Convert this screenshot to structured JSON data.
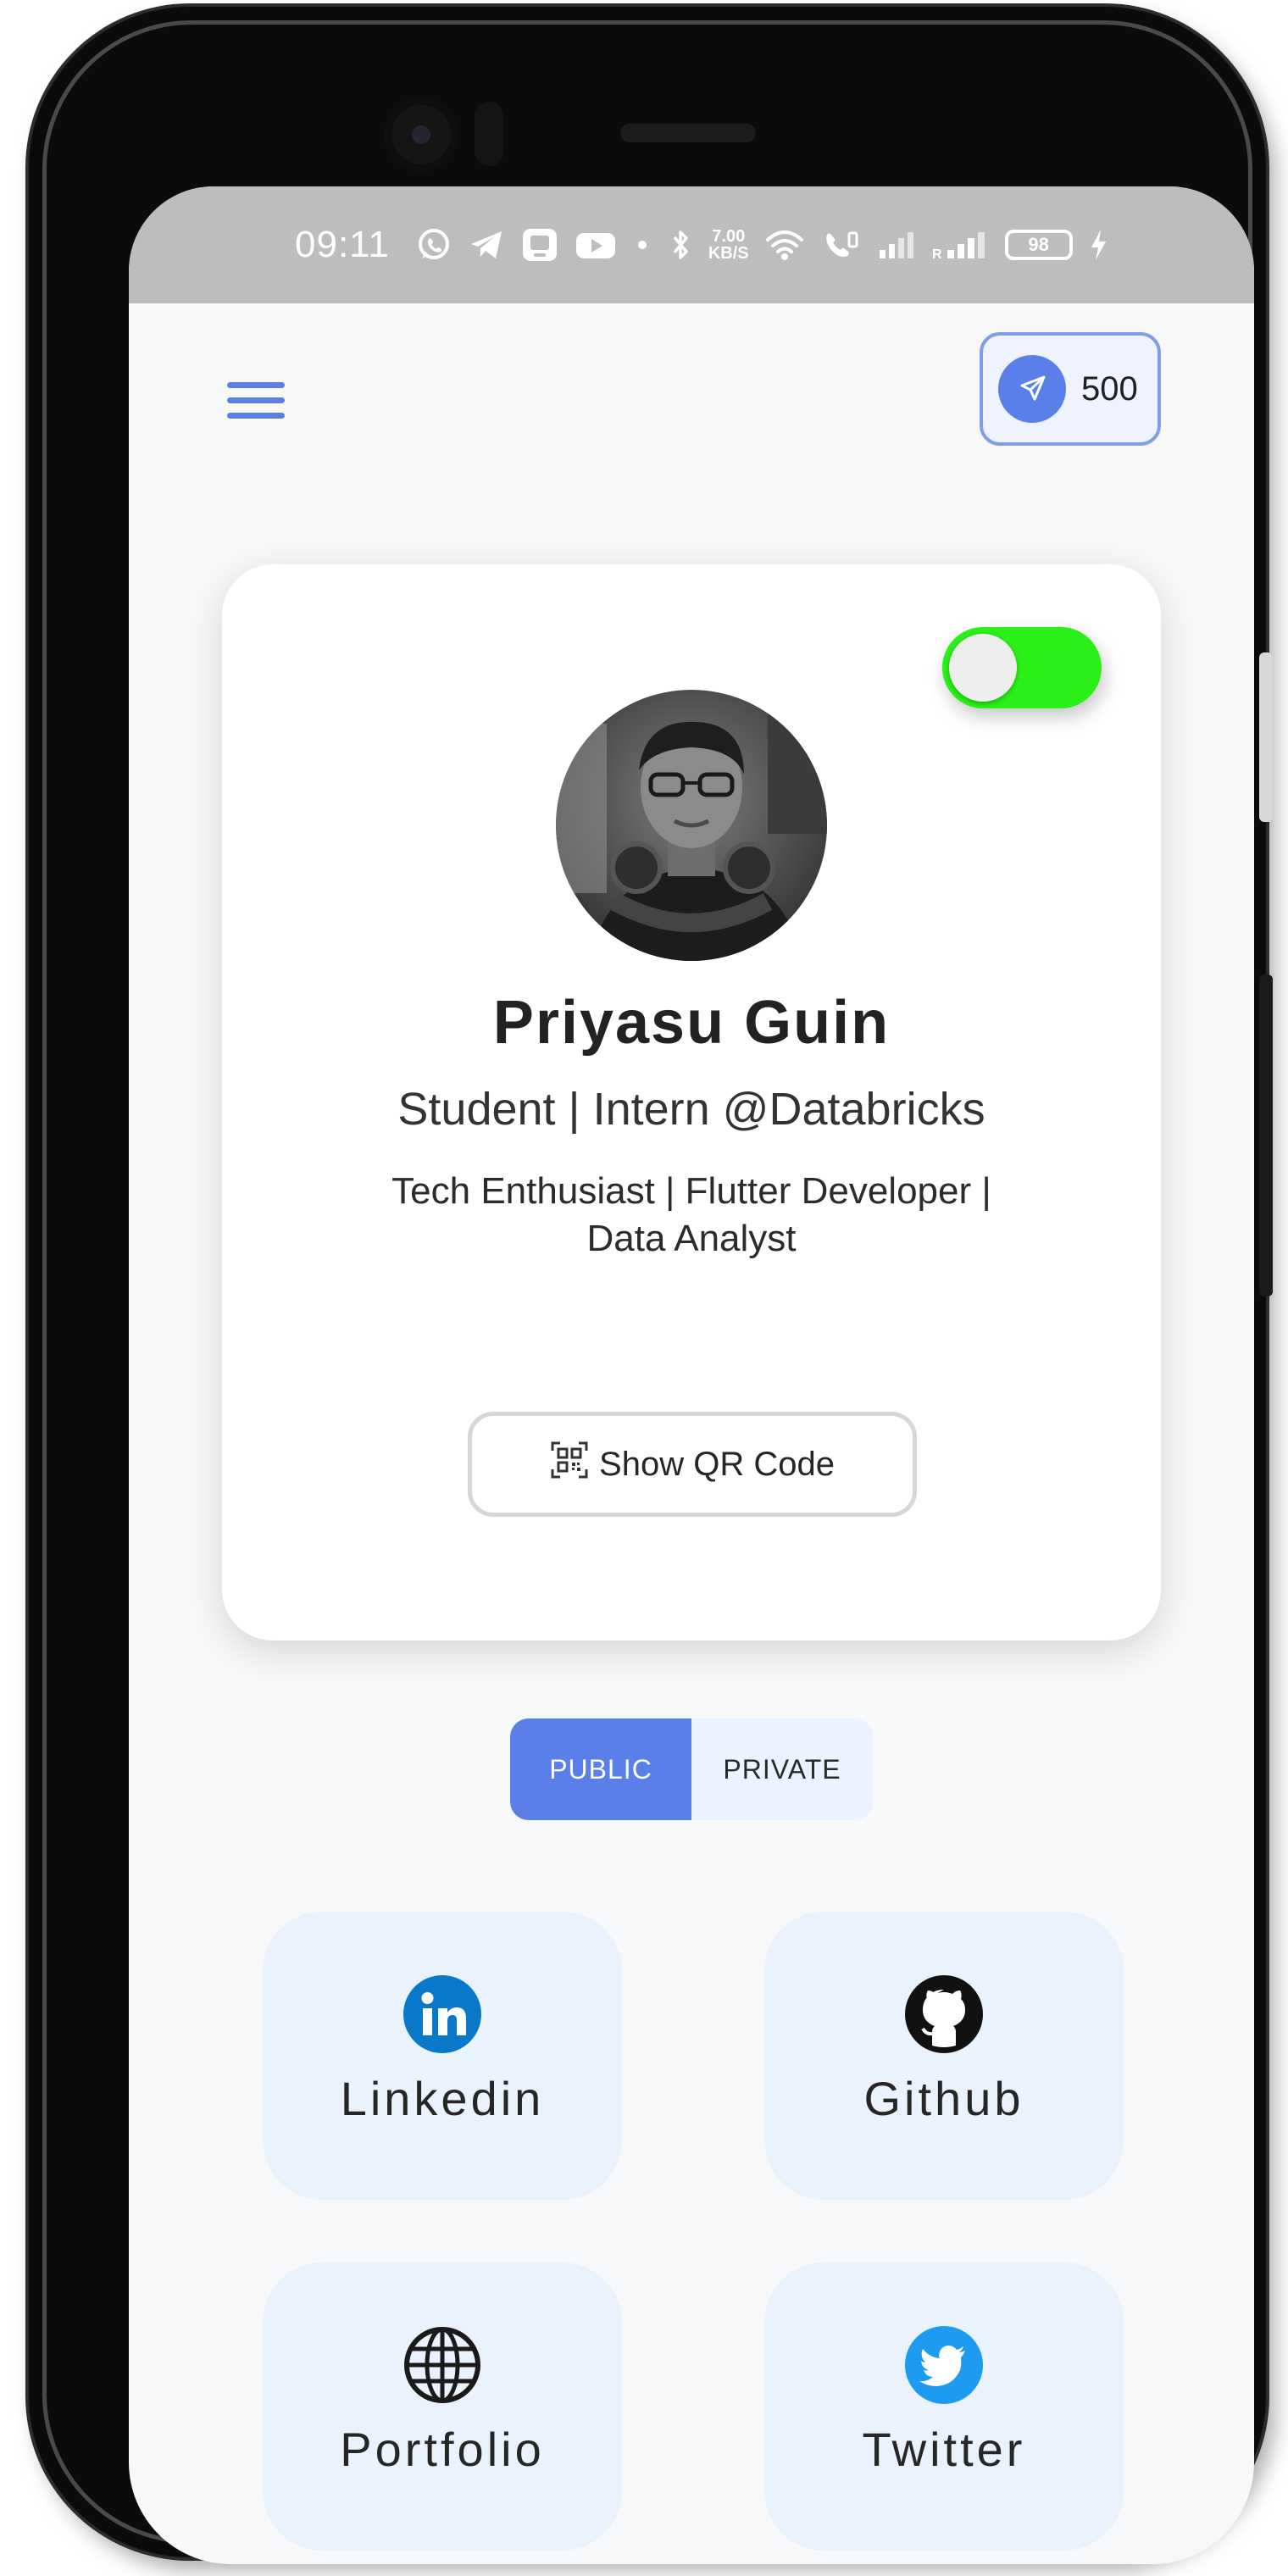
{
  "status_bar": {
    "time": "09:11",
    "net_speed_value": "7.00",
    "net_speed_unit": "KB/S",
    "battery": "98"
  },
  "header": {
    "points": "500"
  },
  "profile": {
    "name": "Priyasu Guin",
    "role": "Student | Intern @Databricks",
    "bio": "Tech Enthusiast | Flutter Developer | Data Analyst",
    "visibility_toggle_on": true,
    "qr_button_label": "Show QR Code"
  },
  "visibility_tabs": [
    {
      "label": "PUBLIC",
      "active": true
    },
    {
      "label": "PRIVATE",
      "active": false
    }
  ],
  "links": [
    {
      "label": "Linkedin",
      "icon": "linkedin-icon"
    },
    {
      "label": "Github",
      "icon": "github-icon"
    },
    {
      "label": "Portfolio",
      "icon": "globe-icon"
    },
    {
      "label": "Twitter",
      "icon": "twitter-icon"
    }
  ],
  "colors": {
    "accent": "#5a7fe9",
    "toggle_on": "#2bf018",
    "tile_background": "#eaf3fd",
    "linkedin": "#0a78c8",
    "twitter": "#1d9bf0"
  }
}
